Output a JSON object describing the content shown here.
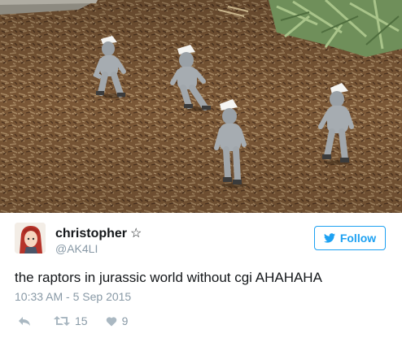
{
  "photo": {
    "subject": "four people in grey suits and paper hats on wood chips"
  },
  "tweet": {
    "display_name": "christopher",
    "verified_star": "☆",
    "handle": "@AK4LI",
    "follow_label": "Follow",
    "text": "the raptors in jurassic world without cgi AHAHAHA",
    "timestamp": "10:33 AM - 5 Sep 2015",
    "retweet_count": "15",
    "like_count": "9"
  },
  "icons": {
    "reply": "reply-icon",
    "retweet": "retweet-icon",
    "like": "heart-icon",
    "follow": "bird-icon"
  },
  "colors": {
    "accent": "#1da1f2",
    "muted": "#8899a6",
    "action": "#aab8c2",
    "text": "#14171a"
  }
}
